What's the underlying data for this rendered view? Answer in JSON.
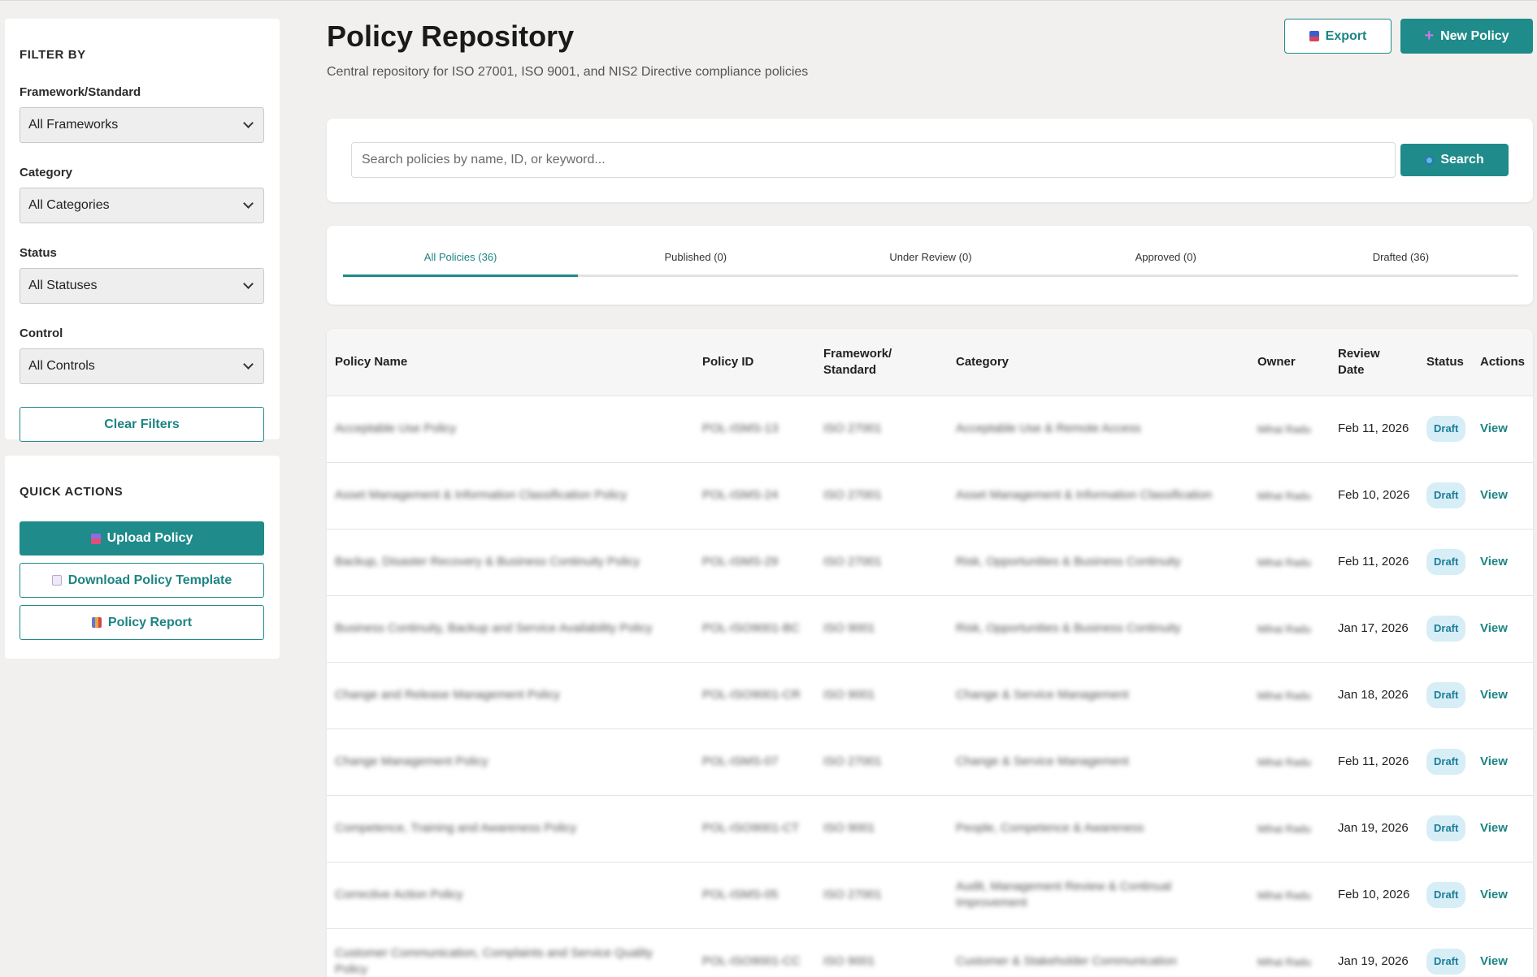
{
  "sidebar": {
    "filters": {
      "title": "FILTER BY",
      "framework_label": "Framework/Standard",
      "framework_value": "All Frameworks",
      "category_label": "Category",
      "category_value": "All Categories",
      "status_label": "Status",
      "status_value": "All Statuses",
      "control_label": "Control",
      "control_value": "All Controls",
      "clear_label": "Clear Filters"
    },
    "quick_actions": {
      "title": "QUICK ACTIONS",
      "upload_label": "Upload Policy",
      "download_label": "Download Policy Template",
      "report_label": "Policy Report"
    }
  },
  "header": {
    "title": "Policy Repository",
    "subtitle": "Central repository for ISO 27001, ISO 9001, and NIS2 Directive compliance policies",
    "export_label": "Export",
    "new_label": "New Policy"
  },
  "search": {
    "placeholder": "Search policies by name, ID, or keyword...",
    "button_label": "Search"
  },
  "tabs": [
    {
      "label": "All Policies (36)"
    },
    {
      "label": "Published (0)"
    },
    {
      "label": "Under Review (0)"
    },
    {
      "label": "Approved (0)"
    },
    {
      "label": "Drafted (36)"
    }
  ],
  "table": {
    "headers": {
      "name": "Policy Name",
      "id": "Policy ID",
      "framework": "Framework/ Standard",
      "category": "Category",
      "owner": "Owner",
      "review": "Review Date",
      "status": "Status",
      "actions": "Actions"
    },
    "rows": [
      {
        "name": "Acceptable Use Policy",
        "id": "POL-ISMS-13",
        "framework": "ISO 27001",
        "category": "Acceptable Use & Remote Access",
        "owner": "Mihai Radu",
        "review": "Feb 11, 2026",
        "status": "Draft",
        "action": "View"
      },
      {
        "name": "Asset Management & Information Classification Policy",
        "id": "POL-ISMS-24",
        "framework": "ISO 27001",
        "category": "Asset Management & Information Classification",
        "owner": "Mihai Radu",
        "review": "Feb 10, 2026",
        "status": "Draft",
        "action": "View"
      },
      {
        "name": "Backup, Disaster Recovery & Business Continuity Policy",
        "id": "POL-ISMS-29",
        "framework": "ISO 27001",
        "category": "Risk, Opportunities & Business Continuity",
        "owner": "Mihai Radu",
        "review": "Feb 11, 2026",
        "status": "Draft",
        "action": "View"
      },
      {
        "name": "Business Continuity, Backup and Service Availability Policy",
        "id": "POL-ISO9001-BC",
        "framework": "ISO 9001",
        "category": "Risk, Opportunities & Business Continuity",
        "owner": "Mihai Radu",
        "review": "Jan 17, 2026",
        "status": "Draft",
        "action": "View"
      },
      {
        "name": "Change and Release Management Policy",
        "id": "POL-ISO9001-CR",
        "framework": "ISO 9001",
        "category": "Change & Service Management",
        "owner": "Mihai Radu",
        "review": "Jan 18, 2026",
        "status": "Draft",
        "action": "View"
      },
      {
        "name": "Change Management Policy",
        "id": "POL-ISMS-07",
        "framework": "ISO 27001",
        "category": "Change & Service Management",
        "owner": "Mihai Radu",
        "review": "Feb 11, 2026",
        "status": "Draft",
        "action": "View"
      },
      {
        "name": "Competence, Training and Awareness Policy",
        "id": "POL-ISO9001-CT",
        "framework": "ISO 9001",
        "category": "People, Competence & Awareness",
        "owner": "Mihai Radu",
        "review": "Jan 19, 2026",
        "status": "Draft",
        "action": "View"
      },
      {
        "name": "Corrective Action Policy",
        "id": "POL-ISMS-05",
        "framework": "ISO 27001",
        "category": "Audit, Management Review & Continual Improvement",
        "owner": "Mihai Radu",
        "review": "Feb 10, 2026",
        "status": "Draft",
        "action": "View"
      },
      {
        "name": "Customer Communication, Complaints and Service Quality Policy",
        "id": "POL-ISO9001-CC",
        "framework": "ISO 9001",
        "category": "Customer & Stakeholder Communication",
        "owner": "Mihai Radu",
        "review": "Jan 19, 2026",
        "status": "Draft",
        "action": "View"
      }
    ]
  }
}
